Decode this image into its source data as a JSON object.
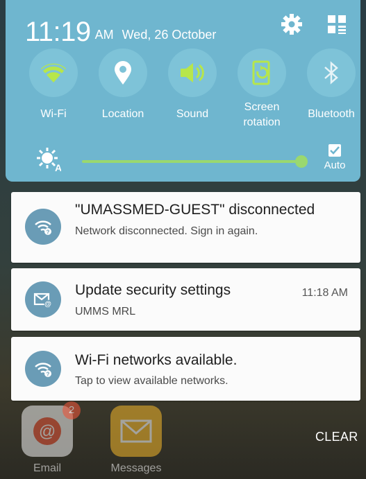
{
  "status_bar": {
    "time": "11:19",
    "ampm": "AM",
    "date": "Wed, 26 October"
  },
  "quick_settings": {
    "tiles": [
      {
        "label": "Wi-Fi",
        "icon": "wifi-icon",
        "active": true
      },
      {
        "label": "Location",
        "icon": "location-icon",
        "active": false
      },
      {
        "label": "Sound",
        "icon": "sound-icon",
        "active": true
      },
      {
        "label": "Screen rotation",
        "icon": "screen-rotation-icon",
        "active": true
      },
      {
        "label": "Bluetooth",
        "icon": "bluetooth-icon",
        "active": false
      }
    ],
    "brightness": {
      "level": 0.93,
      "auto_label": "Auto",
      "auto_checked": true
    }
  },
  "notifications": [
    {
      "title": "\"UMASSMED-GUEST\" disconnected",
      "text": "Network disconnected. Sign in again.",
      "time": "",
      "icon": "wifi-question-icon"
    },
    {
      "title": "Update security settings",
      "text": "UMMS MRL",
      "time": "11:18 AM",
      "icon": "email-security-icon"
    },
    {
      "title": "Wi-Fi networks available.",
      "text": "Tap to view available networks.",
      "time": "",
      "icon": "wifi-question-icon"
    }
  ],
  "clear_label": "CLEAR",
  "home_apps": [
    {
      "label": "Email",
      "badge": "2"
    },
    {
      "label": "Messages",
      "badge": ""
    }
  ],
  "colors": {
    "panel": "#6fb6cf",
    "active_tile": "#b7e64a",
    "brightness_track": "#9ad86f",
    "notification_icon_bg": "#6a9cb6"
  }
}
